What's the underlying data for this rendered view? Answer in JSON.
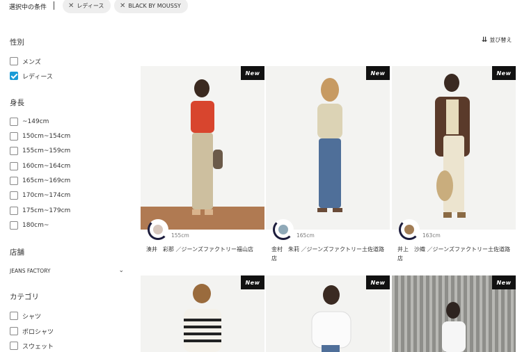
{
  "filterbar": {
    "title": "選択中の条件",
    "chips": [
      "レディース",
      "BLACK BY MOUSSY"
    ]
  },
  "sidebar": {
    "gender": {
      "title": "性別",
      "options": [
        {
          "label": "メンズ",
          "checked": false
        },
        {
          "label": "レディース",
          "checked": true
        }
      ]
    },
    "height": {
      "title": "身長",
      "options": [
        "~149cm",
        "150cm~154cm",
        "155cm~159cm",
        "160cm~164cm",
        "165cm~169cm",
        "170cm~174cm",
        "175cm~179cm",
        "180cm~"
      ]
    },
    "store": {
      "title": "店舗",
      "selected": "JEANS FACTORY"
    },
    "category": {
      "title": "カテゴリ",
      "options": [
        "シャツ",
        "ポロシャツ",
        "スウェット"
      ]
    }
  },
  "sort": {
    "label": "並び替え"
  },
  "cards": [
    {
      "badge": "New",
      "height": "155cm",
      "caption": "湊井　彩那 ／ジーンズファクトリー福山店"
    },
    {
      "badge": "New",
      "height": "165cm",
      "caption": "金村　朱莉 ／ジーンズファクトリー土佐道路店"
    },
    {
      "badge": "New",
      "height": "163cm",
      "caption": "井上　沙織 ／ジーンズファクトリー土佐道路店"
    },
    {
      "badge": "New"
    },
    {
      "badge": "New"
    },
    {
      "badge": "New"
    }
  ],
  "colors": {
    "accent": "#1a9bd7",
    "badge": "#111111",
    "chip": "#eeeeee"
  }
}
